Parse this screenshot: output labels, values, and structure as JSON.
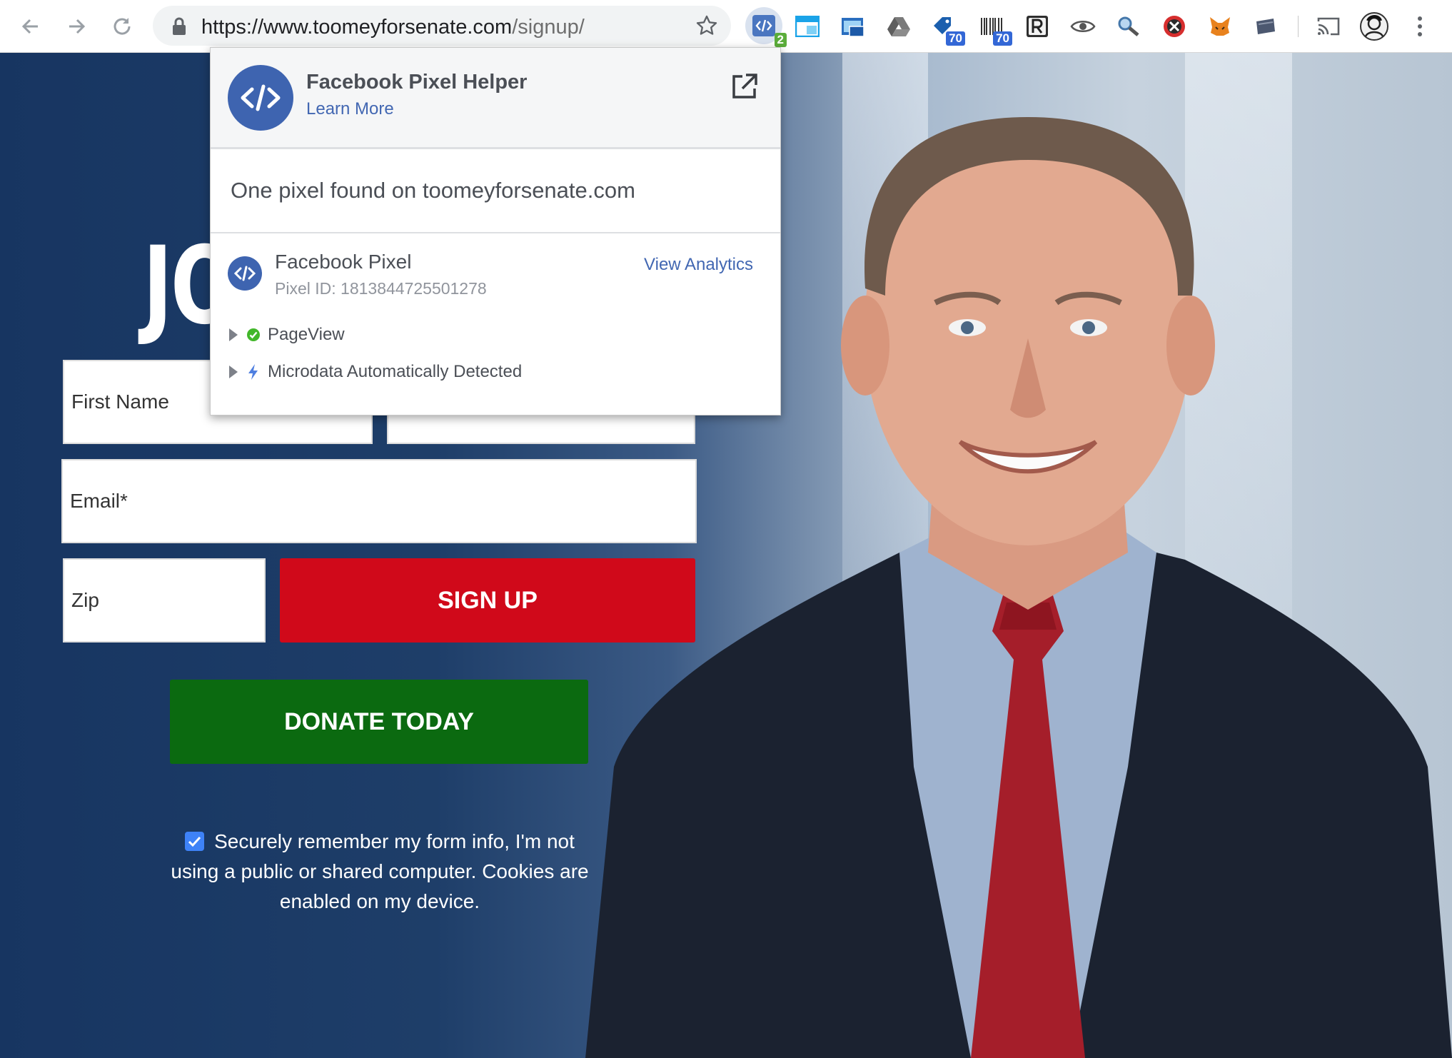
{
  "browser": {
    "url_host": "https://www.toomeyforsenate.com",
    "url_path": "/signup/",
    "extensions": [
      {
        "name": "facebook-pixel-helper",
        "badge": "2",
        "badge_color": "#5bad3b"
      },
      {
        "name": "window-extension"
      },
      {
        "name": "screenshot-extension"
      },
      {
        "name": "google-drive"
      },
      {
        "name": "tag-extension",
        "badge": "70",
        "badge_color": "#3367d6"
      },
      {
        "name": "barcode-extension",
        "badge": "70",
        "badge_color": "#3367d6"
      },
      {
        "name": "r-extension"
      },
      {
        "name": "eye-extension"
      },
      {
        "name": "magnifier-extension"
      },
      {
        "name": "blocker-extension"
      },
      {
        "name": "metamask-fox"
      },
      {
        "name": "card-extension"
      }
    ]
  },
  "page": {
    "headline": "JO",
    "form": {
      "first_name_placeholder": "First Name",
      "last_name_placeholder": "",
      "email_placeholder": "Email*",
      "zip_placeholder": "Zip",
      "signup_label": "SIGN UP",
      "donate_label": "DONATE TODAY",
      "remember_text": "Securely remember my form info, I'm not using a public or shared computer. Cookies are enabled on my device.",
      "remember_checked": true
    },
    "colors": {
      "signup": "#d0091a",
      "donate": "#0b6a10",
      "background": "#1d3a63"
    }
  },
  "popup": {
    "title": "Facebook Pixel Helper",
    "learn_more": "Learn More",
    "summary": "One pixel found on toomeyforsenate.com",
    "pixel": {
      "name": "Facebook Pixel",
      "id_label": "Pixel ID: 1813844725501278",
      "analytics_link": "View Analytics",
      "events": [
        {
          "label": "PageView",
          "icon": "check-icon"
        },
        {
          "label": "Microdata Automatically Detected",
          "icon": "lightning-icon"
        }
      ]
    }
  }
}
